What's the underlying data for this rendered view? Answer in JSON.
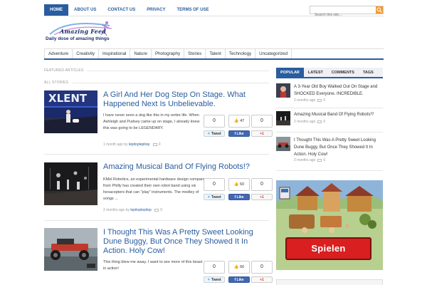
{
  "topnav": {
    "items": [
      {
        "label": "HOME",
        "active": true
      },
      {
        "label": "ABOUT US"
      },
      {
        "label": "CONTACT US"
      },
      {
        "label": "PRIVACY"
      },
      {
        "label": "TERMS OF USE"
      }
    ]
  },
  "search": {
    "placeholder": "Search this site...",
    "button_icon": "search-icon"
  },
  "logo": {
    "title": "Amazing Feed",
    "tagline": "Daily dose of amazing things"
  },
  "categories": [
    "Adventure",
    "Creativity",
    "Inspirational",
    "Nature",
    "Photography",
    "Stories",
    "Talent",
    "Technology",
    "Uncategorized"
  ],
  "sections": {
    "featured": "FEATURED ARTICLES",
    "all": "ALL STORIES"
  },
  "articles": [
    {
      "title": "A Girl And Her Dog Step On Stage. What Happened Next Is Unbelievable.",
      "excerpt": "I have never seen a dog like this in my entire life. When Ashleigh and Pudsey came up on stage, I already knew this was going to be LEGENDARY.",
      "date": "1 month ago",
      "by": "by",
      "author": "lepitoplepitop",
      "comments": "0",
      "tweet_count": "0",
      "like_count": "47",
      "plus_count": "0",
      "thumb_text": "XLENT"
    },
    {
      "title": "Amazing Musical Band Of Flying Robots!?",
      "excerpt": "KMel Robotics, an experimental hardware design company from Philly has created their own robot band using six hexacopters that can \"play\" instruments. The medley of songs ...",
      "date": "2 months ago",
      "by": "by",
      "author": "lepitoplepitop",
      "comments": "0",
      "tweet_count": "0",
      "like_count": "60",
      "plus_count": "0"
    },
    {
      "title": "I Thought This Was A Pretty Sweet Looking Dune Buggy, But Once They Showed It In Action. Holy Cow!",
      "excerpt": "This thing blew me away. I want to see more of this beast in action!",
      "date": "",
      "by": "",
      "author": "",
      "comments": "",
      "tweet_count": "0",
      "like_count": "66",
      "plus_count": "0"
    }
  ],
  "share_labels": {
    "tweet": "Tweet",
    "like": "Like",
    "plus": "+1"
  },
  "sidebar": {
    "tabs": [
      {
        "label": "POPULAR",
        "active": true
      },
      {
        "label": "LATEST"
      },
      {
        "label": "COMMENTS"
      },
      {
        "label": "TAGS"
      }
    ],
    "popular": [
      {
        "title": "A 3-Year Old Boy Walked Out On Stage and SHOCKED Everyone. INCREDIBLE.",
        "date": "2 months ago",
        "comments": "0"
      },
      {
        "title": "Amazing Musical Band Of Flying Robots!?",
        "date": "2 months ago",
        "comments": "0"
      },
      {
        "title": "I Thought This Was A Pretty Sweet Looking Dune Buggy, But Once They Showed It In Action. Holy Cow!",
        "date": "2 months ago",
        "comments": "0"
      }
    ]
  },
  "ad": {
    "button_label": "Spielen"
  },
  "colors": {
    "accent": "#2a5d9f",
    "search_button": "#f29a2e",
    "ad_button": "#d91f1f",
    "facebook": "#4267b2"
  }
}
